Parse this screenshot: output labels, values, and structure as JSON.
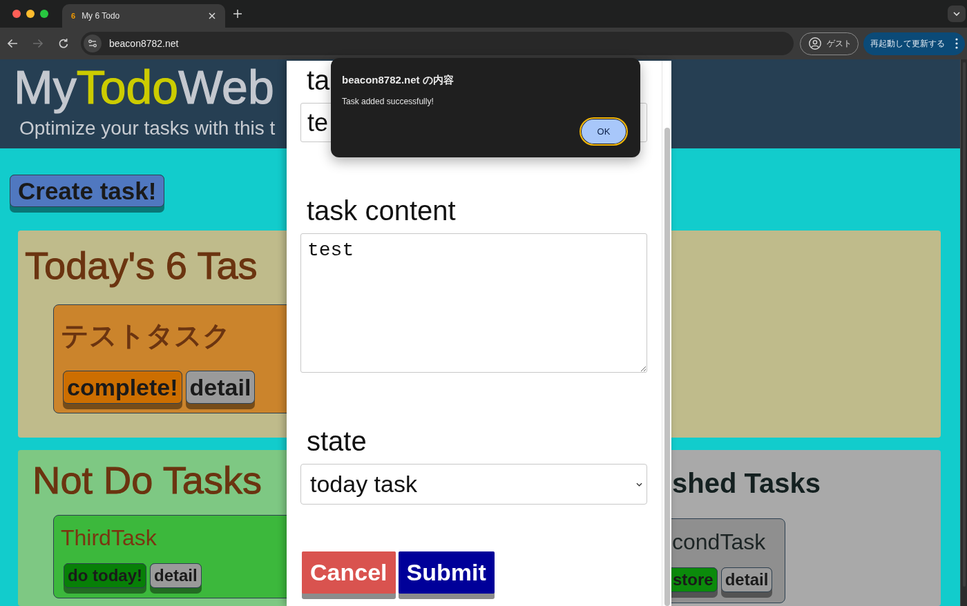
{
  "browser": {
    "tabs": [
      {
        "favicon": "6",
        "title": "My 6 Todo",
        "selected": true
      }
    ],
    "nav_buttons": [
      {
        "kind": "back",
        "disabled": false
      },
      {
        "kind": "forward",
        "disabled": true
      },
      {
        "kind": "reload",
        "disabled": false
      }
    ],
    "url": "beacon8782.net",
    "profile_label": "ゲスト",
    "update_label": "再起動して更新する"
  },
  "header": {
    "title_parts": [
      {
        "text": "My",
        "highlight": false
      },
      {
        "text": "Todo",
        "highlight": true
      },
      {
        "text": "Web",
        "highlight": false
      }
    ],
    "subtitle": "Optimize your tasks with this t"
  },
  "create_button": "Create task!",
  "sections": [
    {
      "kind": "today",
      "title": "Today's 6 Tas",
      "tasks": [
        {
          "title": "テストタスク",
          "actions": [
            {
              "kind": "complete",
              "label": "complete!"
            },
            {
              "kind": "detail",
              "label": "detail"
            }
          ]
        }
      ]
    },
    {
      "kind": "not_do",
      "title": "Not Do Tasks",
      "tasks": [
        {
          "title": "ThirdTask",
          "actions": [
            {
              "kind": "do_today",
              "label": "do today!"
            },
            {
              "kind": "detail",
              "label": "detail"
            }
          ]
        }
      ]
    },
    {
      "kind": "finished",
      "title": "shed Tasks",
      "tasks": [
        {
          "title": "condTask",
          "actions": [
            {
              "kind": "restore",
              "label": "store"
            },
            {
              "kind": "detail",
              "label": "detail"
            }
          ]
        }
      ]
    }
  ],
  "modal": {
    "fields": [
      {
        "kind": "input",
        "label": "ta",
        "value": "te"
      },
      {
        "kind": "textarea",
        "label": "task content",
        "value": "test"
      },
      {
        "kind": "select",
        "label": "state",
        "value": "today task"
      }
    ],
    "buttons": [
      {
        "kind": "cancel",
        "label": "Cancel"
      },
      {
        "kind": "submit",
        "label": "Submit"
      }
    ]
  },
  "alert": {
    "title": "beacon8782.net の内容",
    "message": "Task added successfully!",
    "button": "OK"
  }
}
